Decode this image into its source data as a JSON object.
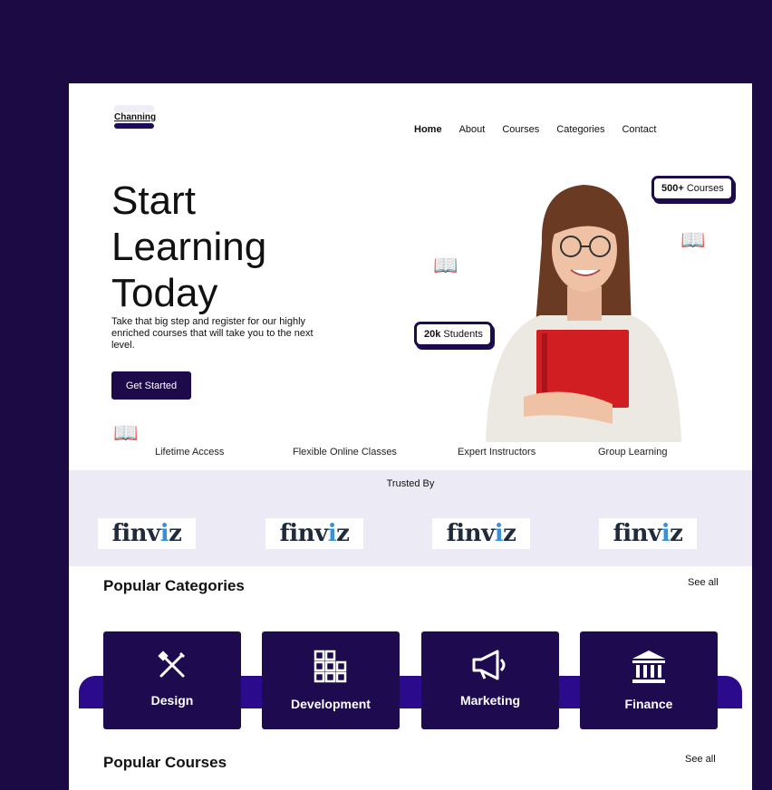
{
  "logo": {
    "text": "Channing"
  },
  "nav": {
    "items": [
      "Home",
      "About",
      "Courses",
      "Categories",
      "Contact"
    ]
  },
  "hero": {
    "title_lines": [
      "Start",
      "Learning",
      "Today"
    ],
    "subtitle": "Take that big step and register for our highly enriched courses that will take you to the next level.",
    "cta_label": "Get Started"
  },
  "badges": {
    "courses": {
      "count": "500+",
      "label": "Courses"
    },
    "students": {
      "count": "20k",
      "label": "Students"
    }
  },
  "features": [
    "Lifetime Access",
    "Flexible Online Classes",
    "Expert Instructors",
    "Group Learning"
  ],
  "trusted": {
    "label": "Trusted By",
    "logos": [
      {
        "text_a": "finv",
        "text_dot": "i",
        "text_b": "z"
      },
      {
        "text_a": "finv",
        "text_dot": "i",
        "text_b": "z"
      },
      {
        "text_a": "finv",
        "text_dot": "i",
        "text_b": "z"
      },
      {
        "text_a": "finv",
        "text_dot": "i",
        "text_b": "z"
      }
    ]
  },
  "categories": {
    "title": "Popular Categories",
    "see_all": "See all",
    "items": [
      {
        "name": "Design",
        "icon": "design-tools-icon"
      },
      {
        "name": "Development",
        "icon": "development-grid-icon"
      },
      {
        "name": "Marketing",
        "icon": "megaphone-icon"
      },
      {
        "name": "Finance",
        "icon": "bank-icon"
      }
    ]
  },
  "courses": {
    "title": "Popular Courses",
    "see_all": "See all"
  },
  "colors": {
    "primary": "#1c0a4a",
    "background": "#1b0a44",
    "accent_band": "#2b0b8c",
    "trusted_bg": "#eceaf5"
  }
}
